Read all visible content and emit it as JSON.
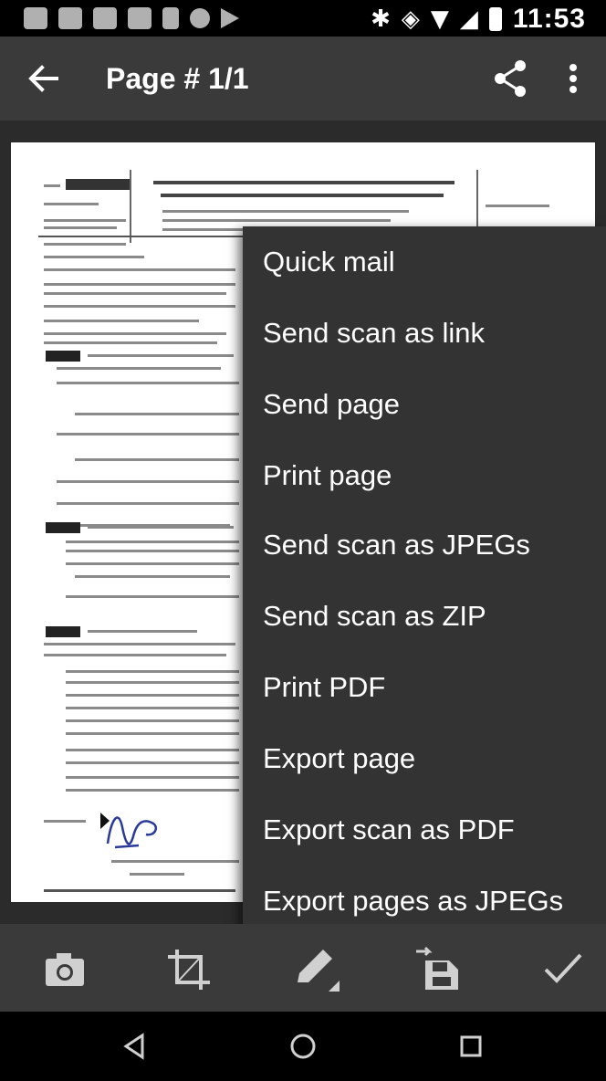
{
  "status_bar": {
    "time": "11:53"
  },
  "toolbar": {
    "title": "Page # 1/1"
  },
  "menu": {
    "items": [
      "Quick mail",
      "Send scan as link",
      "Send page",
      "Print page",
      "Send scan as JPEGs",
      "Send scan as ZIP",
      "Print PDF",
      "Export page",
      "Export scan as PDF",
      "Export pages as JPEGs"
    ]
  },
  "icons": {
    "back": "arrow-back-icon",
    "share": "share-icon",
    "more": "more-vert-icon",
    "camera": "camera-icon",
    "crop": "crop-icon",
    "edit": "pencil-icon",
    "save": "save-icon",
    "done": "check-icon",
    "nav_back": "triangle-back-icon",
    "nav_home": "circle-home-icon",
    "nav_recents": "square-recents-icon"
  }
}
